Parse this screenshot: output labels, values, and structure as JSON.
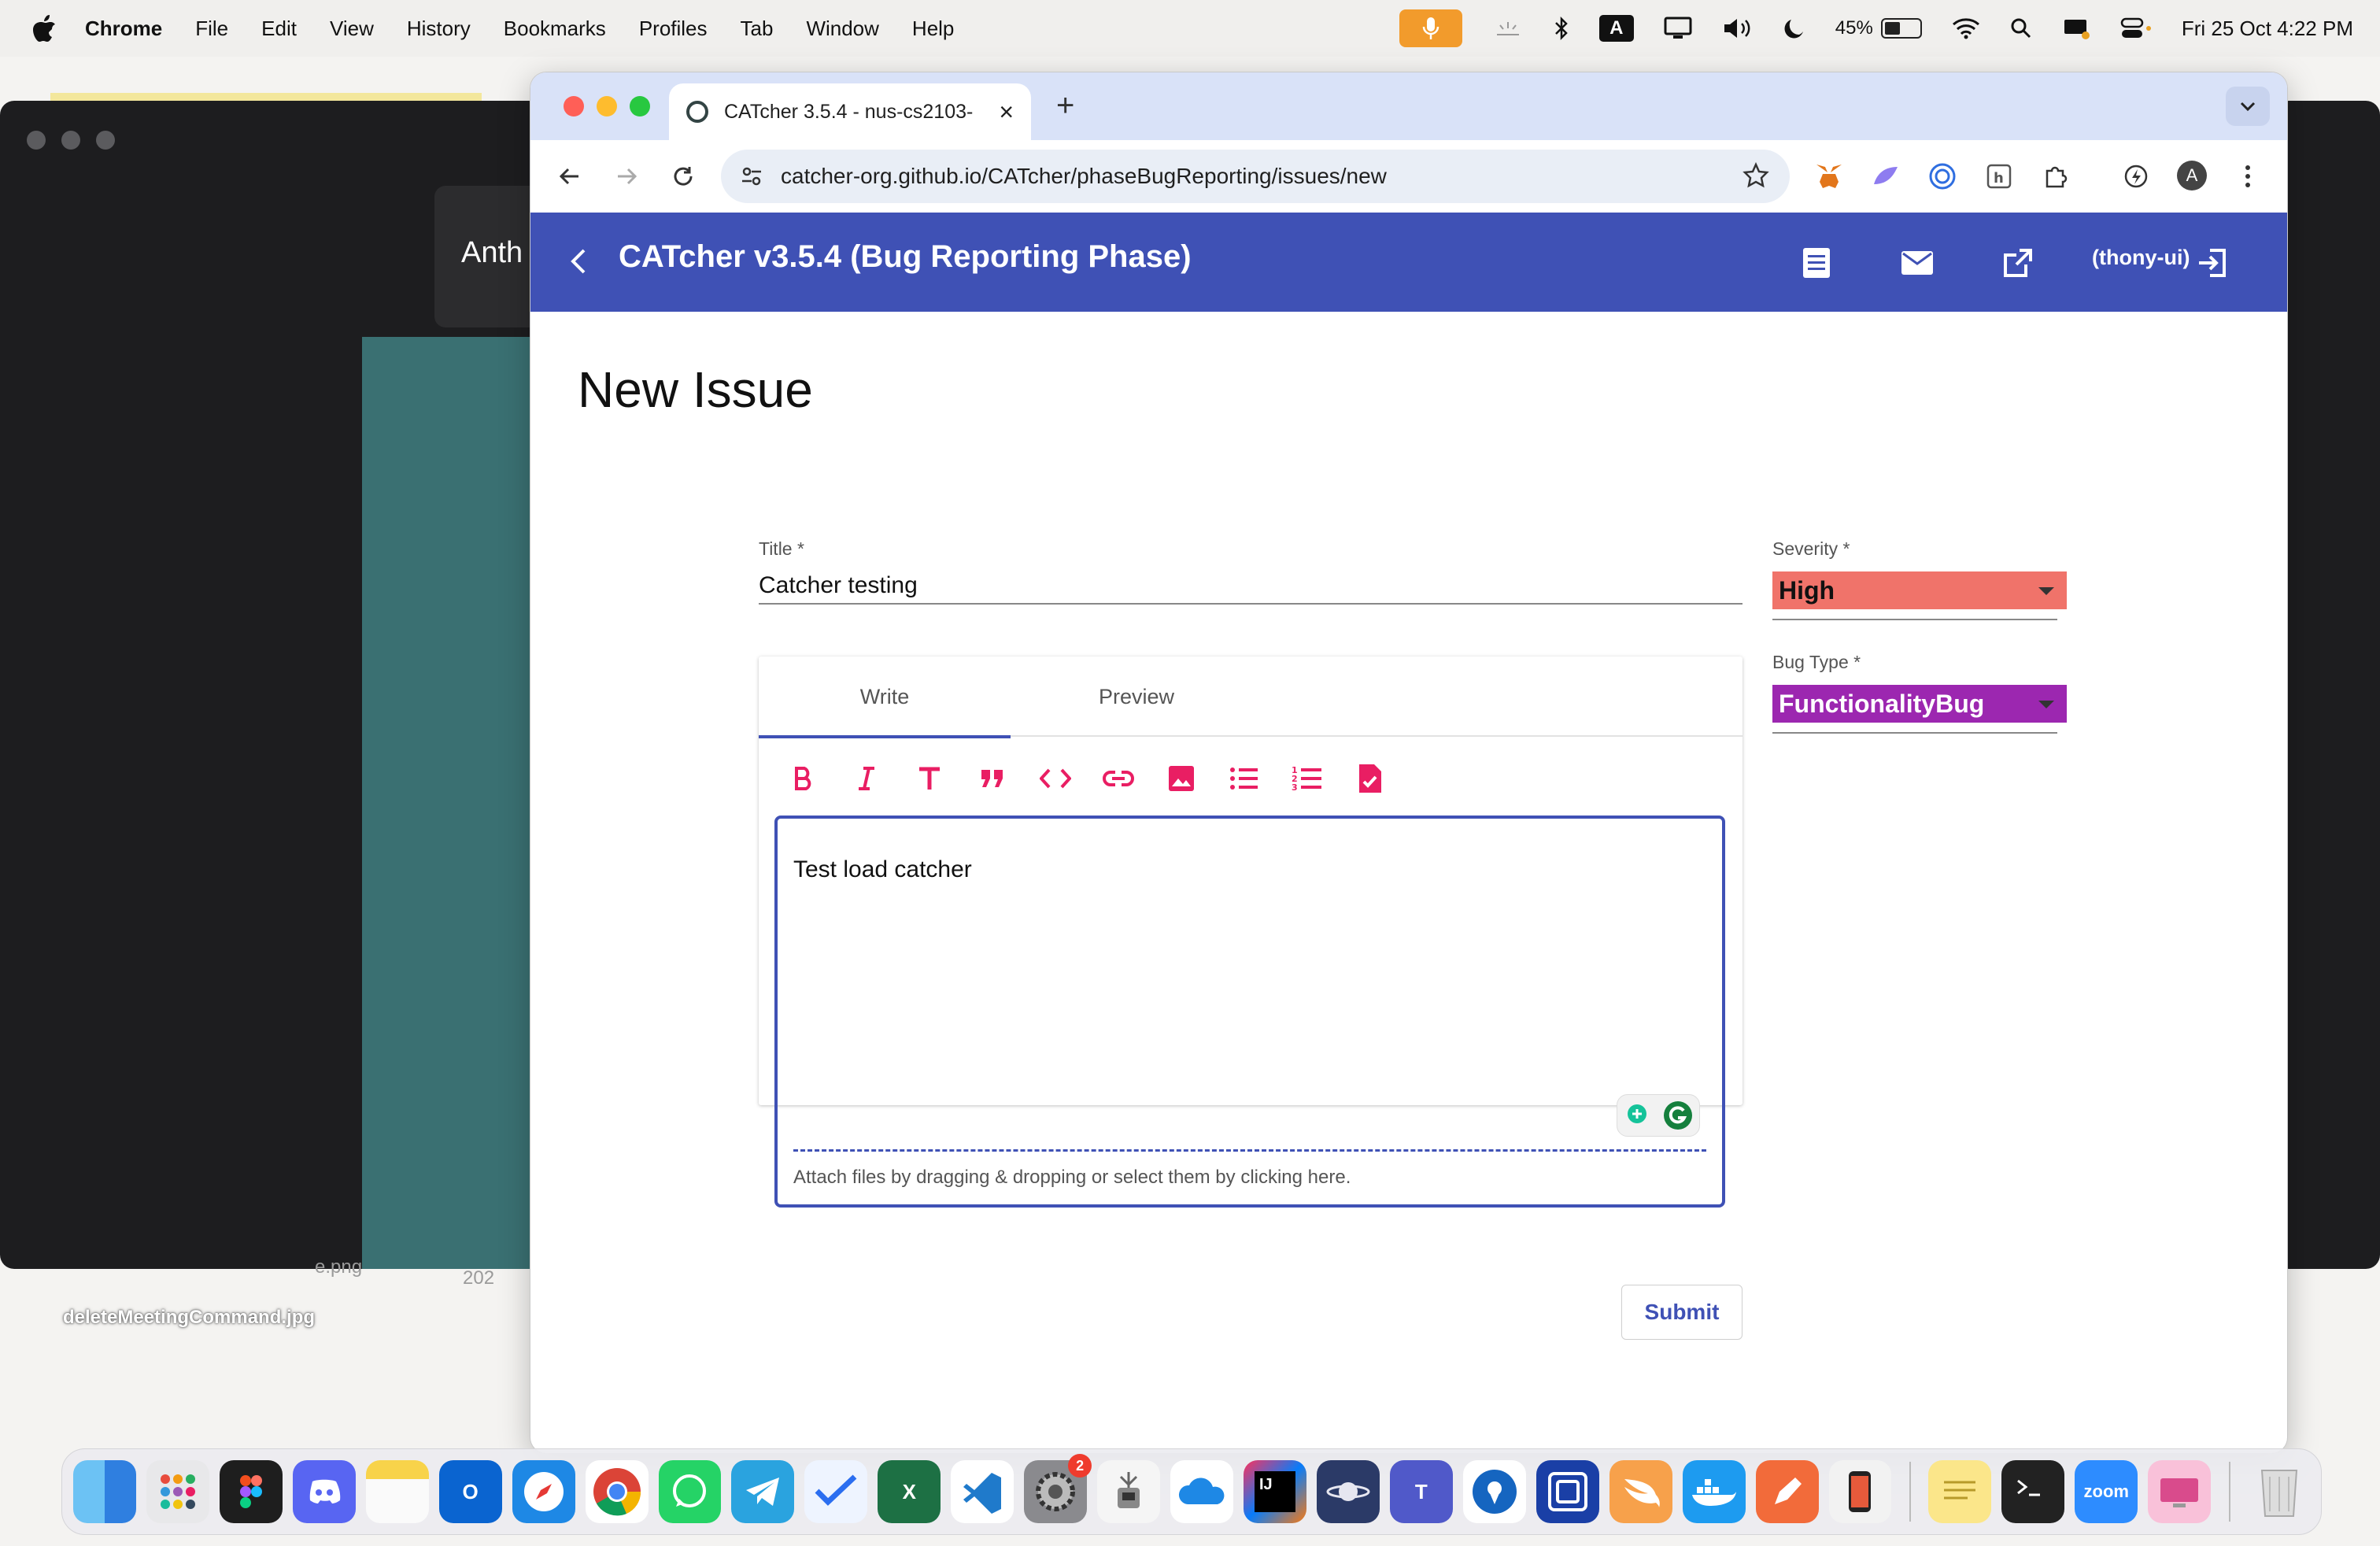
{
  "menubar": {
    "app": "Chrome",
    "items": [
      "File",
      "Edit",
      "View",
      "History",
      "Bookmarks",
      "Profiles",
      "Tab",
      "Window",
      "Help"
    ],
    "battery": "45%",
    "battery_level": 0.45,
    "datetime": "Fri 25 Oct  4:22 PM",
    "keyboard_input": "A"
  },
  "background": {
    "tile_text": "Anth",
    "desktop_file_label": "deleteMeetingCommand.jpg",
    "faint_labels": [
      "e.png",
      "202"
    ]
  },
  "browser": {
    "tab_title": "CATcher 3.5.4 - nus-cs2103-",
    "url": "catcher-org.github.io/CATcher/phaseBugReporting/issues/new",
    "profile_initial": "A"
  },
  "app": {
    "header_title": "CATcher v3.5.4  (Bug Reporting Phase)",
    "user": "(thony-ui)",
    "accent": "#3f51b5"
  },
  "form": {
    "page_title": "New Issue",
    "title_label": "Title *",
    "title_value": "Catcher testing",
    "severity_label": "Severity *",
    "severity_value": "High",
    "severity_color": "#f0736a",
    "bugtype_label": "Bug Type *",
    "bugtype_value": "FunctionalityBug",
    "bugtype_color": "#9c27b0",
    "tabs": [
      "Write",
      "Preview"
    ],
    "active_tab": "Write",
    "toolbar_icons": [
      "bold-icon",
      "italic-icon",
      "heading-icon",
      "quote-icon",
      "code-icon",
      "link-icon",
      "image-icon",
      "bulleted-list-icon",
      "numbered-list-icon",
      "task-list-icon"
    ],
    "description": "Test load catcher",
    "attach_hint": "Attach files by dragging & dropping or select them by clicking here.",
    "submit_label": "Submit"
  },
  "dock": {
    "settings_badge": "2",
    "zoom_label": "zoom"
  }
}
